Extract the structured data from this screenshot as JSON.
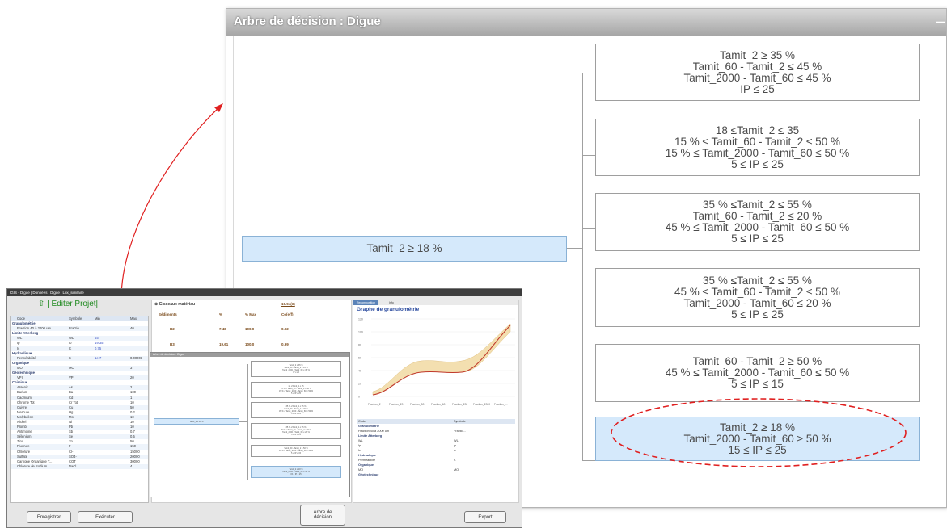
{
  "big_window": {
    "title": "Arbre de décision : Digue",
    "close_glyph": "–",
    "root": {
      "text": "Tamit_2 ≥ 18 %"
    },
    "children": [
      {
        "lines": [
          "Tamit_2 ≥ 35 %",
          "Tamit_60 - Tamit_2 ≤ 45 %",
          "Tamit_2000 - Tamit_60 ≤ 45 %",
          "IP ≤ 25"
        ]
      },
      {
        "lines": [
          "18 ≤Tamit_2 ≤ 35",
          "15 % ≤ Tamit_60 - Tamit_2 ≤ 50 %",
          "15 % ≤ Tamit_2000 - Tamit_60 ≤ 50 %",
          "5 ≤ IP ≤ 25"
        ]
      },
      {
        "lines": [
          "35 % ≤Tamit_2 ≤ 55 %",
          "Tamit_60 - Tamit_2 ≤ 20 %",
          "45 % ≤ Tamit_2000 - Tamit_60 ≤ 50 %",
          "5 ≤ IP ≤ 25"
        ]
      },
      {
        "lines": [
          "35 % ≤Tamit_2 ≤ 55 %",
          "45 % ≤ Tamit_60 - Tamit_2 ≤ 50 %",
          "Tamit_2000 - Tamit_60 ≤ 20 %",
          "5 ≤ IP ≤ 25"
        ]
      },
      {
        "lines": [
          "Tamit_60 - Tamit_2 ≥ 50 %",
          "45 % ≤ Tamit_2000 - Tamit_60 ≤ 50 %",
          "5 ≤ IP ≤ 15"
        ]
      },
      {
        "lines": [
          "Tamit_2 ≥ 18 %",
          "Tamit_2000 - Tamit_60 ≥ 50 %",
          "15 ≤ IP ≤ 25"
        ],
        "highlighted": true
      }
    ]
  },
  "small_window": {
    "title": "IGIS - Digue | Données | Digue | Lux_similaire",
    "edit_project": "⇧ | Editer Projet|",
    "left_panel": {
      "headers": [
        "Code",
        "Symbole",
        "Min",
        "Max"
      ],
      "rows": [
        {
          "type": "section",
          "label": "Granulométrie"
        },
        {
          "label": "Fraction 40 à 2000 um",
          "sym": "Fractio...",
          "min": "",
          "max": "40"
        },
        {
          "type": "section",
          "label": "Limite Atterberg"
        },
        {
          "label": "WL",
          "sym": "WL",
          "min": "45",
          "max": ""
        },
        {
          "label": "Ip",
          "sym": "Ip",
          "min": "19.35",
          "max": ""
        },
        {
          "label": "Ic",
          "sym": "Ic",
          "min": "0.75",
          "max": ""
        },
        {
          "type": "section",
          "label": "Hydraulique"
        },
        {
          "label": "Perméabilité",
          "sym": "K",
          "min": "1e-7",
          "max": "0.00001"
        },
        {
          "type": "section",
          "label": "Organique"
        },
        {
          "label": "MO",
          "sym": "MO",
          "min": "",
          "max": "3"
        },
        {
          "type": "section",
          "label": "Géotechnique"
        },
        {
          "label": "VPI",
          "sym": "VPI",
          "min": "",
          "max": "20"
        },
        {
          "type": "section",
          "label": "Chimique"
        },
        {
          "label": "Arsenic",
          "sym": "As",
          "min": "",
          "max": "2"
        },
        {
          "label": "Barium",
          "sym": "Ba",
          "min": "",
          "max": "100"
        },
        {
          "label": "Cadmium",
          "sym": "Cd",
          "min": "",
          "max": "1"
        },
        {
          "label": "Chrome Tot",
          "sym": "Cr Tot",
          "min": "",
          "max": "10"
        },
        {
          "label": "Cuivre",
          "sym": "Cu",
          "min": "",
          "max": "50"
        },
        {
          "label": "Mercure",
          "sym": "Hg",
          "min": "",
          "max": "0.2"
        },
        {
          "label": "Molybdène",
          "sym": "Mo",
          "min": "",
          "max": "10"
        },
        {
          "label": "Nickel",
          "sym": "Ni",
          "min": "",
          "max": "10"
        },
        {
          "label": "Plomb",
          "sym": "Pb",
          "min": "",
          "max": "10"
        },
        {
          "label": "Antimoine",
          "sym": "Sb",
          "min": "",
          "max": "0.7"
        },
        {
          "label": "Sélénium",
          "sym": "Se",
          "min": "",
          "max": "0.5"
        },
        {
          "label": "Zinc",
          "sym": "Zn",
          "min": "",
          "max": "50"
        },
        {
          "label": "Fluorure",
          "sym": "F-",
          "min": "",
          "max": "150"
        },
        {
          "label": "Chlorure",
          "sym": "Cl-",
          "min": "",
          "max": "15000"
        },
        {
          "label": "Sulfate",
          "sym": "SO4-",
          "min": "",
          "max": "20000"
        },
        {
          "label": "Carbone Organique T...",
          "sym": "COT",
          "min": "",
          "max": "30000"
        },
        {
          "label": "Chlorure de Sodium",
          "sym": "NaCl",
          "min": "",
          "max": "4"
        }
      ]
    },
    "mid_panel": {
      "header": "⊕ Gisseaux matériau",
      "col_labels": [
        "%",
        "% Max",
        "Co(eff)"
      ],
      "top_value": "10.94(€)",
      "section": "Sédiments",
      "rows": [
        {
          "label": "B2",
          "pct": "7.48",
          "max": "100.0",
          "coeff": "0.92"
        },
        {
          "label": "B3",
          "pct": "19.61",
          "max": "100.0",
          "coeff": "0.99"
        }
      ]
    },
    "mini_tree": {
      "title": "Arbre de décision : Digue",
      "root": "Tamit_2 ≥ 18 %",
      "nodes": [
        [
          "Tamit_2 ≥ 35 %",
          "Tamit_60 - Tamit_2 ≤ 45 %",
          "Tamit_2000 - Tamit_60 ≤ 45 %",
          "IP ≤ 25"
        ],
        [
          "18 ≤Tamit_2 ≤ 35",
          "15 % ≤ Tamit_60 - Tamit_2 ≤ 50 %",
          "15 % ≤ Tamit_2000 - Tamit_60 ≤ 50 %",
          "5 ≤ IP ≤ 25"
        ],
        [
          "35 % ≤Tamit_2 ≤ 55 %",
          "Tamit_60 - Tamit_2 ≤ 20 %",
          "45 % ≤ Tamit_2000 - Tamit_60 ≤ 50 %",
          "5 ≤ IP ≤ 25"
        ],
        [
          "35 % ≤Tamit_2 ≤ 55 %",
          "45 % ≤ Tamit_60 - Tamit_2 ≤ 50 %",
          "Tamit_2000 - Tamit_60 ≤ 20 %",
          "5 ≤ IP ≤ 25"
        ],
        [
          "Tamit_60 - Tamit_2 ≥ 50 %",
          "45 % ≤ Tamit_2000 - Tamit_60 ≤ 50 %",
          "5 ≤ IP ≤ 15"
        ],
        [
          "Tamit_2 ≥ 18 %",
          "Tamit_2000 - Tamit_60 ≥ 50 %",
          "15 ≤ IP ≤ 25"
        ]
      ]
    },
    "right_panel": {
      "tabs": [
        "Recomposition",
        "Info"
      ],
      "graph_title": "Graphe de granulométrie",
      "y_ticks": [
        "120",
        "100",
        "80",
        "60",
        "40",
        "20",
        "0"
      ],
      "x_ticks": [
        "Fraction_2",
        "Fraction_20",
        "Fraction_50",
        "Fraction_60",
        "Fraction_200",
        "Fraction_2000",
        "Fraction_..."
      ],
      "table_headers": [
        "Code",
        "Symbole"
      ],
      "table_rows": [
        {
          "type": "section",
          "a": "Granulométrie",
          "b": ""
        },
        {
          "a": "Fraction 40 à 2000 um",
          "b": "Fractio..."
        },
        {
          "type": "section",
          "a": "Limite Atterberg",
          "b": ""
        },
        {
          "a": "WL",
          "b": "WL"
        },
        {
          "a": "Ip",
          "b": "Ip"
        },
        {
          "a": "Ic",
          "b": "Ic"
        },
        {
          "type": "section",
          "a": "Hydraulique",
          "b": ""
        },
        {
          "a": "Perméabilité",
          "b": "K"
        },
        {
          "type": "section",
          "a": "Organique",
          "b": ""
        },
        {
          "a": "MO",
          "b": "MO"
        },
        {
          "type": "section",
          "a": "Géotechnique",
          "b": ""
        }
      ]
    },
    "buttons": {
      "save": "Enregistrer",
      "run": "Exécuter",
      "tree_line1": "Arbre de",
      "tree_line2": "décision",
      "export": "Export"
    }
  },
  "colors": {
    "highlight_fill": "#d5e9fb",
    "ellipse": "#e02020",
    "arrow": "#e02020",
    "curve": "#c0392b",
    "band": "#f3dfb0"
  }
}
